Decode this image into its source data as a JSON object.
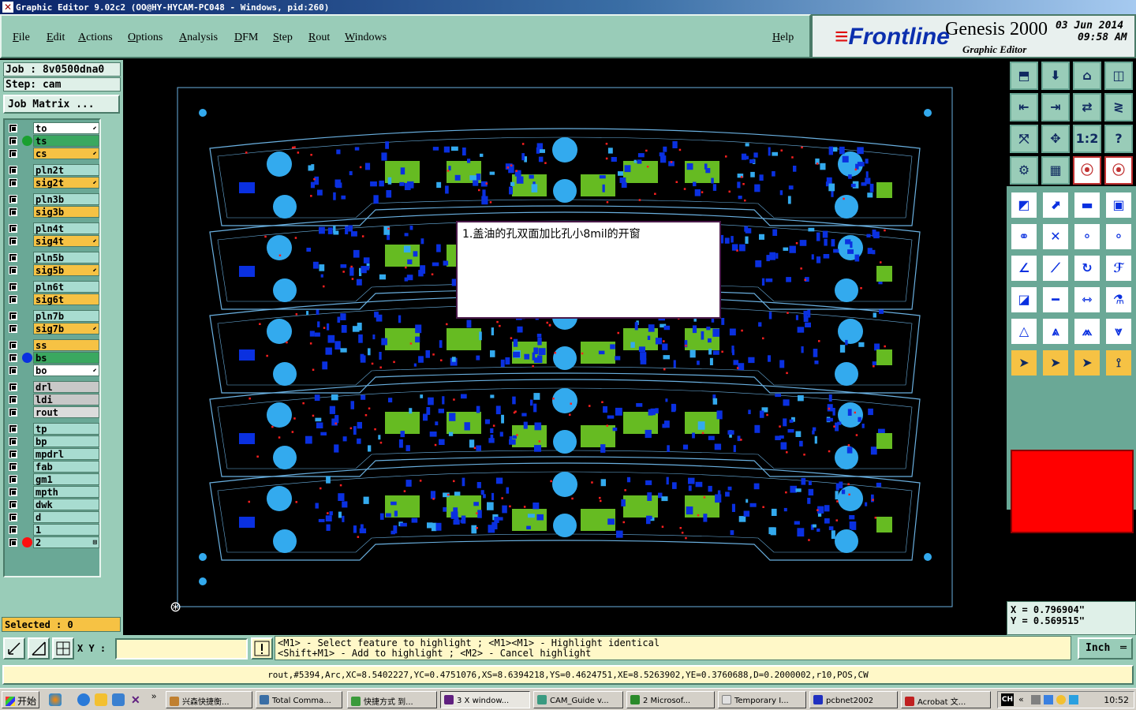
{
  "window": {
    "title": "Graphic Editor 9.02c2 (OO@HY-HYCAM-PC048 - Windows, pid:260)"
  },
  "menu": {
    "items": [
      "File",
      "Edit",
      "Actions",
      "Options",
      "Analysis",
      "DFM",
      "Step",
      "Rout",
      "Windows"
    ],
    "help": "Help"
  },
  "brand": {
    "logo_prefix": "Frontline",
    "product": "Genesis 2000",
    "subtitle": "Graphic Editor",
    "date": "03 Jun 2014",
    "time": "09:58 AM"
  },
  "job": {
    "job_label": "Job : 8v0500dna0",
    "step_label": "Step: cam",
    "matrix_button": "Job Matrix ..."
  },
  "layers": [
    {
      "name": "to",
      "color": "#ffffff",
      "mark": "⬋",
      "dot": ""
    },
    {
      "name": "ts",
      "color": "#3aa860",
      "mark": "",
      "dot": "#1aa030"
    },
    {
      "name": "cs",
      "color": "#f6c244",
      "mark": "⬋",
      "dot": ""
    },
    {
      "name": "pln2t",
      "color": "#a8dcd0",
      "mark": "",
      "dot": ""
    },
    {
      "name": "sig2t",
      "color": "#f6c244",
      "mark": "⬋",
      "dot": ""
    },
    {
      "name": "pln3b",
      "color": "#a8dcd0",
      "mark": "",
      "dot": ""
    },
    {
      "name": "sig3b",
      "color": "#f6c244",
      "mark": "",
      "dot": ""
    },
    {
      "name": "pln4t",
      "color": "#a8dcd0",
      "mark": "",
      "dot": ""
    },
    {
      "name": "sig4t",
      "color": "#f6c244",
      "mark": "⬋",
      "dot": ""
    },
    {
      "name": "pln5b",
      "color": "#a8dcd0",
      "mark": "",
      "dot": ""
    },
    {
      "name": "sig5b",
      "color": "#f6c244",
      "mark": "⬋",
      "dot": ""
    },
    {
      "name": "pln6t",
      "color": "#a8dcd0",
      "mark": "",
      "dot": ""
    },
    {
      "name": "sig6t",
      "color": "#f6c244",
      "mark": "",
      "dot": ""
    },
    {
      "name": "pln7b",
      "color": "#a8dcd0",
      "mark": "",
      "dot": ""
    },
    {
      "name": "sig7b",
      "color": "#f6c244",
      "mark": "⬋",
      "dot": ""
    },
    {
      "name": "ss",
      "color": "#f6c244",
      "mark": "",
      "dot": ""
    },
    {
      "name": "bs",
      "color": "#3aa860",
      "mark": "",
      "dot": "#0a30e0"
    },
    {
      "name": "bo",
      "color": "#ffffff",
      "mark": "⬋",
      "dot": ""
    },
    {
      "name": "drl",
      "color": "#c8c8c8",
      "mark": "",
      "dot": ""
    },
    {
      "name": "ldi",
      "color": "#c8c8c8",
      "mark": "",
      "dot": ""
    },
    {
      "name": "rout",
      "color": "#dcdcdc",
      "mark": "",
      "dot": ""
    },
    {
      "name": "tp",
      "color": "#a8dcd0",
      "mark": "",
      "dot": ""
    },
    {
      "name": "bp",
      "color": "#a8dcd0",
      "mark": "",
      "dot": ""
    },
    {
      "name": "mpdrl",
      "color": "#a8dcd0",
      "mark": "",
      "dot": ""
    },
    {
      "name": "fab",
      "color": "#a8dcd0",
      "mark": "",
      "dot": ""
    },
    {
      "name": "gm1",
      "color": "#a8dcd0",
      "mark": "",
      "dot": ""
    },
    {
      "name": "mpth",
      "color": "#a8dcd0",
      "mark": "",
      "dot": ""
    },
    {
      "name": "dwk",
      "color": "#a8dcd0",
      "mark": "",
      "dot": ""
    },
    {
      "name": "d",
      "color": "#a8dcd0",
      "mark": "",
      "dot": ""
    },
    {
      "name": "1",
      "color": "#a8dcd0",
      "mark": "",
      "dot": ""
    },
    {
      "name": "2",
      "color": "#a8dcd0",
      "mark": "⊞",
      "dot": "#ff1010"
    }
  ],
  "selected": "Selected : 0",
  "popup": {
    "text": "1.盖油的孔双面加比孔小8mil的开窗"
  },
  "colors": {
    "pad_blue": "#0a30e0",
    "pad_cyan": "#33aaee",
    "pad_green": "#66bb22",
    "trace_red": "#ff2020",
    "outline": "#6ab0e0",
    "panel_green": "#99ccb8",
    "highlight": "#ff0000"
  },
  "coords": {
    "x": "X = 0.796904\"",
    "y": "Y = 0.569515\""
  },
  "input": {
    "xy_label": "X Y :",
    "xy_value": ""
  },
  "help": {
    "line1": "<M1> - Select feature to highlight ; <M1><M1> - Highlight identical",
    "line2": "<Shift+M1> - Add to highlight ; <M2> - Cancel highlight"
  },
  "units": "Inch",
  "status": "rout,#5394,Arc,XC=8.5402227,YC=0.4751076,XS=8.6394218,YS=0.4624751,XE=8.5263902,YE=0.3760688,D=0.2000002,r10,POS,CW",
  "taskbar": {
    "start": "开始",
    "tasks": [
      "兴森快捷衡...",
      "Total Comma...",
      "快捷方式 到...",
      "3 X window...",
      "CAM_Guide v...",
      "2 Microsof...",
      "Temporary I...",
      "pcbnet2002",
      "Acrobat 文..."
    ],
    "tray_lang": "CH",
    "clock": "10:52"
  }
}
